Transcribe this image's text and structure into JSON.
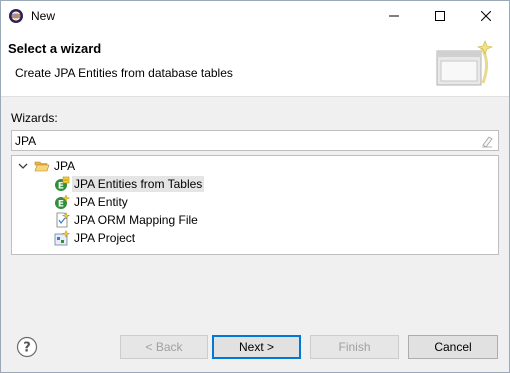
{
  "window": {
    "title": "New",
    "app_icon": "eclipse-icon",
    "controls": [
      "minimize-icon",
      "maximize-icon",
      "close-icon"
    ]
  },
  "header": {
    "title": "Select a wizard",
    "description": "Create JPA Entities from database tables",
    "banner_icon": "wizard-banner-icon"
  },
  "filter": {
    "label": "Wizards:",
    "value": "JPA",
    "clear_icon": "eraser-icon"
  },
  "tree": {
    "category": {
      "label": "JPA",
      "icon": "folder-open-icon",
      "expanded": true
    },
    "items": [
      {
        "label": "JPA Entities from Tables",
        "icon": "jpa-entities-icon",
        "selected": true
      },
      {
        "label": "JPA Entity",
        "icon": "jpa-entity-icon",
        "selected": false
      },
      {
        "label": "JPA ORM Mapping File",
        "icon": "jpa-orm-file-icon",
        "selected": false
      },
      {
        "label": "JPA Project",
        "icon": "jpa-project-icon",
        "selected": false
      }
    ]
  },
  "buttons": {
    "help_icon": "help-icon",
    "back": "< Back",
    "next": "Next >",
    "finish": "Finish",
    "cancel": "Cancel"
  },
  "colors": {
    "selection": "#e5e5e5",
    "default_button_border": "#0078d7",
    "banner": "#ffffff"
  }
}
